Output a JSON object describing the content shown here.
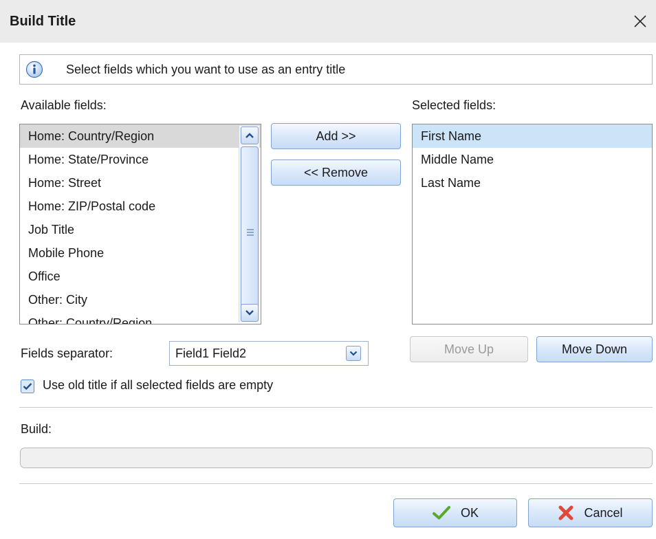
{
  "window": {
    "title": "Build Title"
  },
  "info": {
    "text": "Select fields which you want to use as an entry title"
  },
  "available": {
    "label": "Available fields:",
    "items": [
      "Home: Country/Region",
      "Home: State/Province",
      "Home: Street",
      "Home: ZIP/Postal code",
      "Job Title",
      "Mobile Phone",
      "Office",
      "Other: City",
      "Other: Country/Region"
    ]
  },
  "selected": {
    "label": "Selected fields:",
    "items": [
      "First Name",
      "Middle Name",
      "Last Name"
    ]
  },
  "buttons": {
    "add": "Add >>",
    "remove": "<< Remove",
    "move_up": "Move Up",
    "move_down": "Move Down",
    "ok": "OK",
    "cancel": "Cancel"
  },
  "separator": {
    "label": "Fields separator:",
    "value": "Field1 Field2"
  },
  "checkbox": {
    "label": "Use old title if all selected fields are empty",
    "checked": true
  },
  "build": {
    "label": "Build:",
    "value": ""
  },
  "colors": {
    "accent": "#7fa4d2",
    "selection": "#cce4f7",
    "ok_check": "#5aa82a",
    "cancel_x": "#e0483a"
  },
  "icons": [
    "close-icon",
    "info-icon",
    "scroll-up-icon",
    "scroll-down-icon",
    "dropdown-arrow-icon",
    "checkmark-icon",
    "cross-icon"
  ]
}
